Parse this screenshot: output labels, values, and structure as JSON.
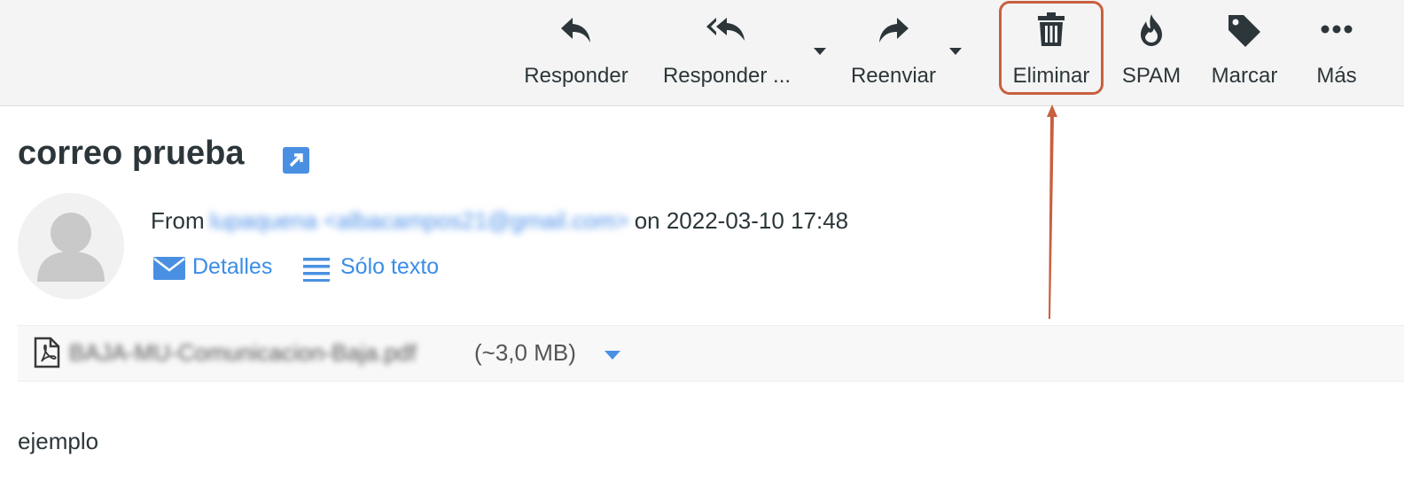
{
  "toolbar": {
    "buttons": [
      {
        "label": "Responder",
        "icon": "reply-icon"
      },
      {
        "label": "Responder ...",
        "icon": "reply-all-icon"
      },
      {
        "label": "Reenviar",
        "icon": "forward-icon"
      },
      {
        "label": "Eliminar",
        "icon": "trash-icon"
      },
      {
        "label": "SPAM",
        "icon": "spam-flame-icon"
      },
      {
        "label": "Marcar",
        "icon": "tag-icon"
      },
      {
        "label": "Más",
        "icon": "more-dots-icon"
      }
    ],
    "highlighted": "Eliminar",
    "highlight_color": "#c8603f"
  },
  "message": {
    "subject": "correo prueba",
    "from_label": "From",
    "from_address": "lupaquena <albacampos21@gmail.com>",
    "date_text": "on 2022-03-10 17:48",
    "details_label": "Detalles",
    "plain_text_label": "Sólo texto",
    "attachment": {
      "name": "BAJA-MU-Comunicacion-Baja.pdf",
      "size": "(~3,0 MB)"
    },
    "body": "ejemplo"
  },
  "colors": {
    "link": "#3b8de8",
    "toolbar_bg": "#f4f4f4",
    "text": "#2c363a"
  }
}
